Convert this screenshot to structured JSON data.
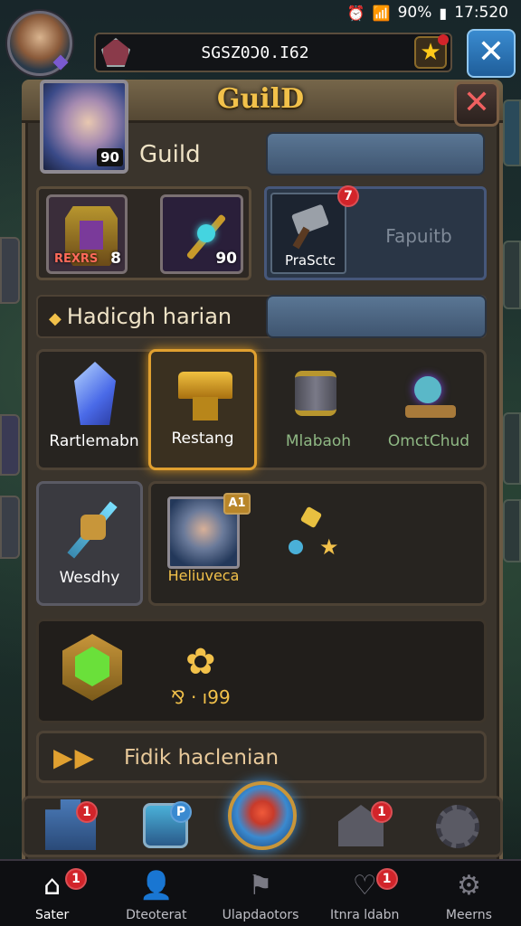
{
  "status": {
    "battery_pct": "90%",
    "time": "17:520"
  },
  "top": {
    "player_id": "SGSZ0Ɔ0.I62",
    "close_label": "✕"
  },
  "panel": {
    "title": "GuilD",
    "close_label": "✕",
    "guild_level": "90",
    "guild_name": "Guild"
  },
  "row_items": {
    "emblem_count": "8",
    "emblem_tag": "REXRS",
    "wand_count": "90",
    "practice_label": "PraSctc",
    "practice_badge": "7",
    "practice_right": "Fapuitb"
  },
  "section": {
    "title": "Hadicgh harian"
  },
  "grid": [
    {
      "label": "Rartlemabn"
    },
    {
      "label": "Restang"
    },
    {
      "label": "Mlabaoh"
    },
    {
      "label": "OmctChud"
    }
  ],
  "row4": {
    "left_label": "Wesdhy",
    "hero_name": "Heliuveca",
    "hero_badge": "A1"
  },
  "row5": {
    "reward_text": "⅋ · ı99"
  },
  "row6": {
    "text": "Fidik haclenian"
  },
  "dock_badges": {
    "tower": "1",
    "shield": "P",
    "house": "1"
  },
  "nav": [
    {
      "label": "Sater",
      "icon": "house-icon",
      "badge": "1"
    },
    {
      "label": "Dteoterat",
      "icon": "person-icon",
      "badge": ""
    },
    {
      "label": "Ulapdaotors",
      "icon": "flag-icon",
      "badge": ""
    },
    {
      "label": "Itnra ldabn",
      "icon": "heart-icon",
      "badge": "1"
    },
    {
      "label": "Meerns",
      "icon": "gear-icon",
      "badge": ""
    }
  ],
  "colors": {
    "accent_gold": "#f2c14a",
    "badge_red": "#d2242a",
    "close_blue": "#3a8bd0"
  }
}
